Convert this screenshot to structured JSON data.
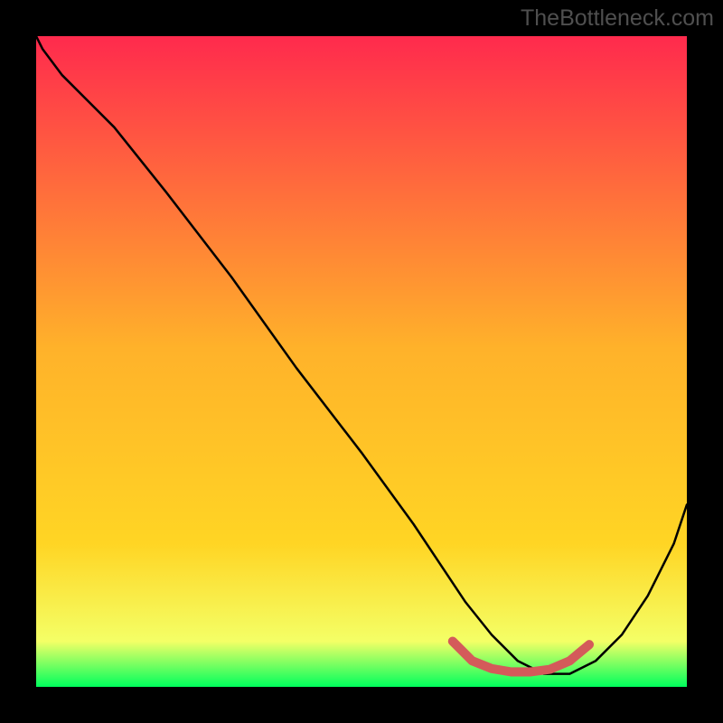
{
  "watermark": "TheBottleneck.com",
  "chart_data": {
    "type": "line",
    "title": "",
    "xlabel": "",
    "ylabel": "",
    "xlim": [
      0,
      100
    ],
    "ylim": [
      0,
      100
    ],
    "grid": false,
    "legend": null,
    "gradient": {
      "top_color": "#ff2a4d",
      "mid_color": "#ffd524",
      "bottom_color": "#00ff5d"
    },
    "background_series": {
      "name": "gradient-fill",
      "x": [
        0,
        100
      ],
      "y_top": [
        100,
        100
      ],
      "y_bottom": [
        0,
        0
      ]
    },
    "series": [
      {
        "name": "black-curve",
        "color": "#000000",
        "x": [
          0,
          1,
          4,
          8,
          12,
          20,
          30,
          40,
          50,
          58,
          62,
          66,
          70,
          74,
          78,
          82,
          86,
          90,
          94,
          98,
          100
        ],
        "y": [
          100,
          98,
          94,
          90,
          86,
          76,
          63,
          49,
          36,
          25,
          19,
          13,
          8,
          4,
          2,
          2,
          4,
          8,
          14,
          22,
          28
        ]
      },
      {
        "name": "red-segment",
        "color": "#d45a5a",
        "x": [
          64,
          67,
          70,
          73,
          76,
          79,
          82,
          85
        ],
        "y": [
          7,
          4,
          2.8,
          2.3,
          2.3,
          2.7,
          4,
          6.5
        ]
      }
    ]
  }
}
